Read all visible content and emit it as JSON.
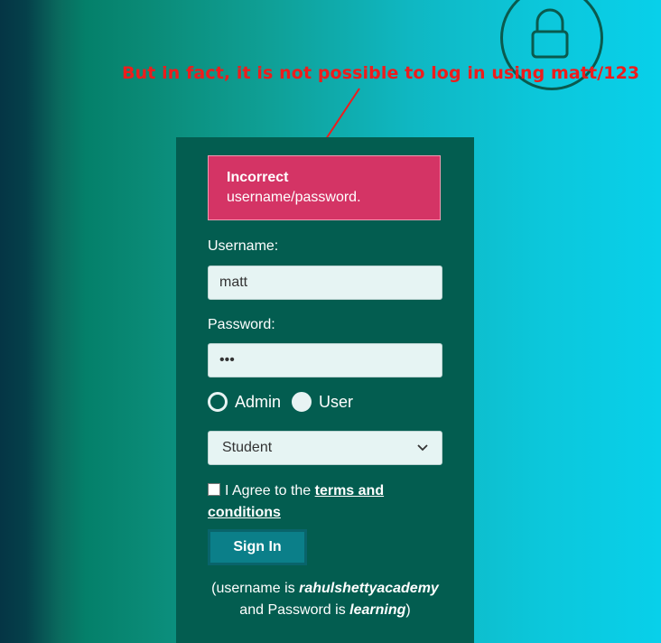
{
  "annotation": "But in fact, it is not possible to log in using matt/123",
  "alert": {
    "title": "Incorrect",
    "message": "username/password."
  },
  "form": {
    "username_label": "Username:",
    "username_value": "matt",
    "password_label": "Password:",
    "password_value": "•••",
    "roles": [
      {
        "label": "Admin",
        "selected": true
      },
      {
        "label": "User",
        "selected": false
      }
    ],
    "select_value": "Student",
    "agree_prefix": "I Agree to the ",
    "agree_link": "terms and conditions",
    "signin_label": "Sign In"
  },
  "hint": {
    "prefix": "(username is ",
    "username": "rahulshettyacademy",
    "middle": "and Password is ",
    "password": "learning",
    "suffix": ")"
  },
  "colors": {
    "alert": "#d43465",
    "panel": "#035d50",
    "annotation": "#ee1c1c",
    "button": "#0b7f89"
  }
}
